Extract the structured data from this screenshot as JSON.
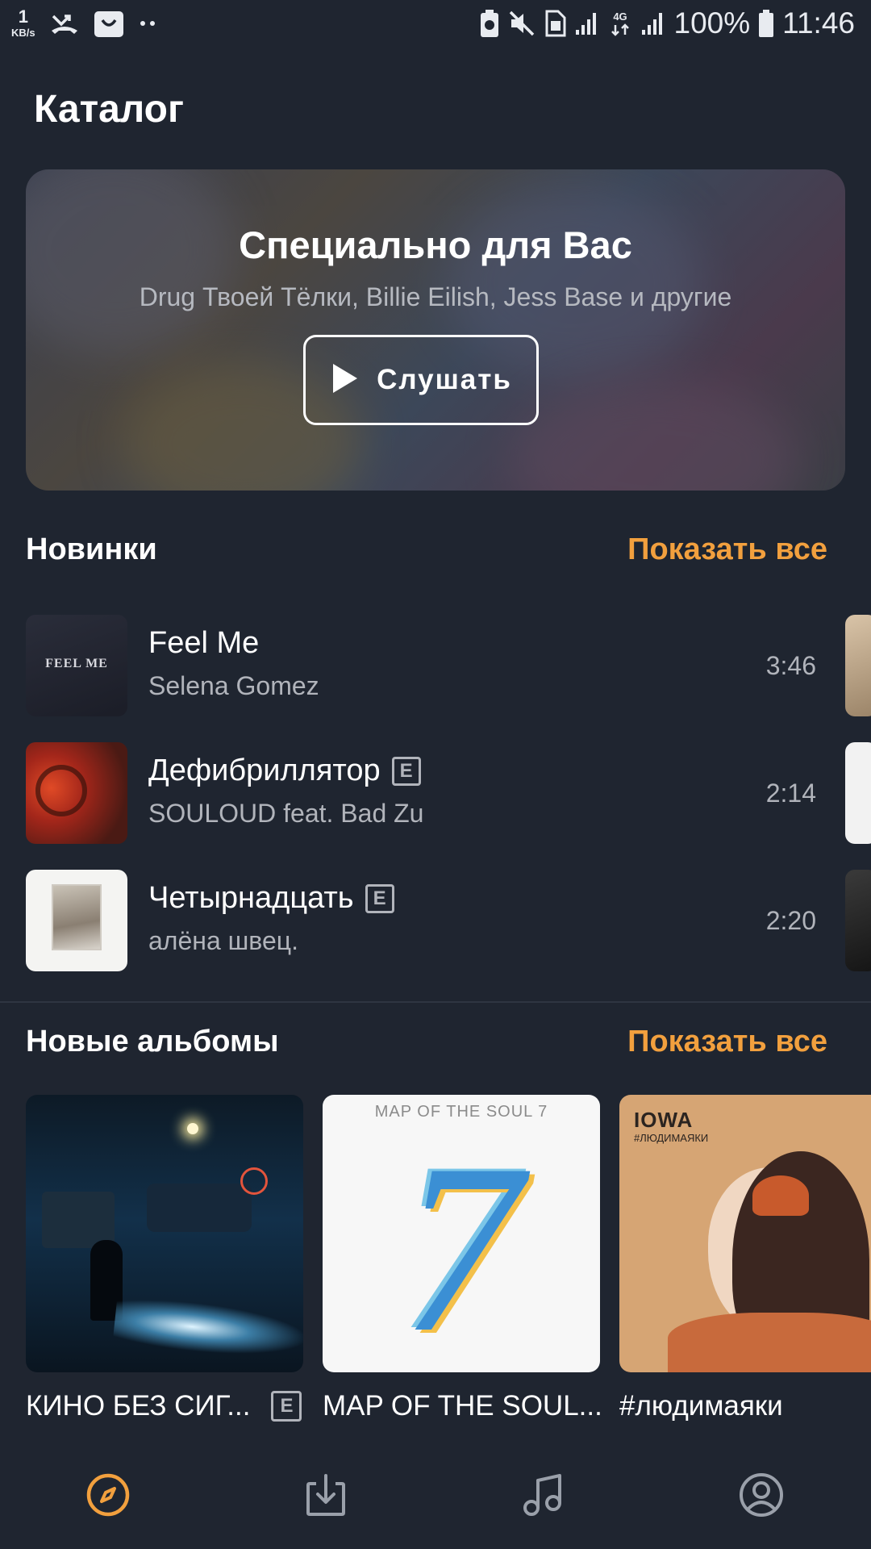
{
  "status_bar": {
    "speed_value": "1",
    "speed_unit": "KB/s",
    "battery_percent": "100%",
    "time": "11:46",
    "network_label": "4G"
  },
  "page_title": "Каталог",
  "hero": {
    "title": "Специально для Вас",
    "subtitle": "Drug Твоей Тёлки, Billie Eilish, Jess Base и другие",
    "button_label": "Слушать"
  },
  "new_tracks": {
    "title": "Новинки",
    "show_all": "Показать все",
    "items": [
      {
        "title": "Feel Me",
        "artist": "Selena Gomez",
        "duration": "3:46",
        "explicit": false,
        "cover_text": "FEEL ME"
      },
      {
        "title": "Дефибриллятор",
        "artist": "SOULOUD feat. Bad Zu",
        "duration": "2:14",
        "explicit": true
      },
      {
        "title": "Четырнадцать",
        "artist": "алёна швец.",
        "duration": "2:20",
        "explicit": true
      }
    ]
  },
  "new_albums": {
    "title": "Новые альбомы",
    "show_all": "Показать все",
    "items": [
      {
        "title": "КИНО БЕЗ СИГ...",
        "explicit": true
      },
      {
        "title": "MAP OF THE SOUL...",
        "explicit": false,
        "cover_top_text": "MAP OF THE SOUL  7",
        "cover_numeral": "7"
      },
      {
        "title": "#людимаяки",
        "explicit": false,
        "cover_brand": "IOWA",
        "cover_sub": "#ЛЮДИМАЯКИ"
      }
    ]
  },
  "explicit_mark": "E",
  "tabs": [
    "compass-icon",
    "download-icon",
    "music-note-icon",
    "profile-icon"
  ],
  "colors": {
    "background": "#1f2530",
    "accent": "#f2a03e",
    "secondary_text": "#b1b4bb"
  }
}
